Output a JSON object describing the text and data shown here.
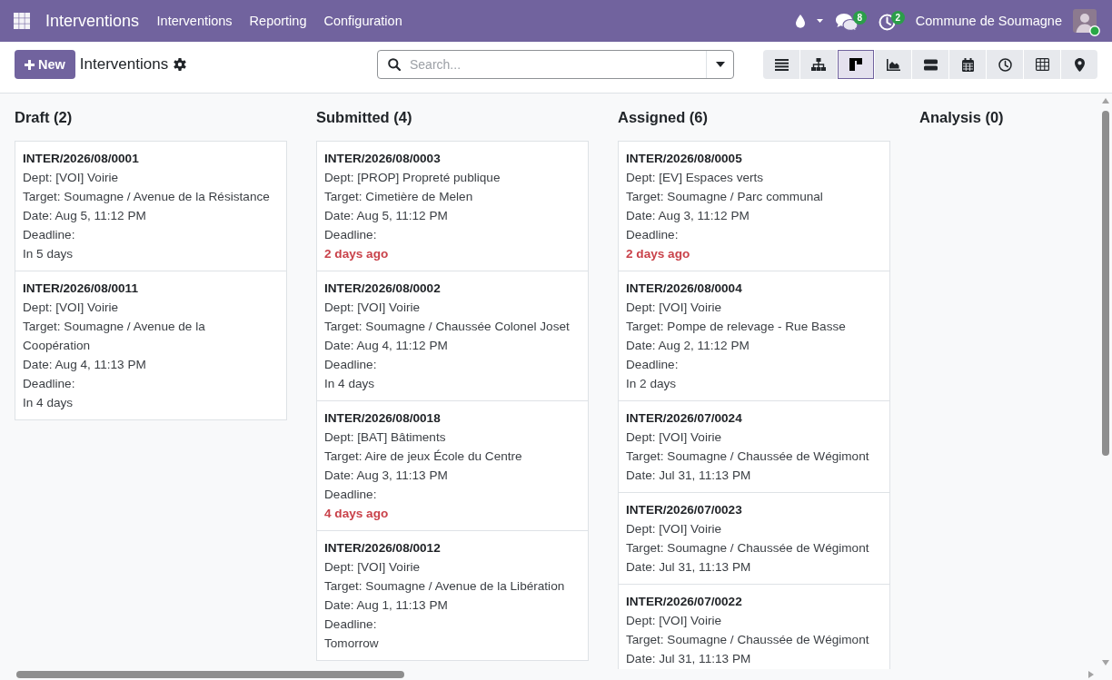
{
  "navbar": {
    "app_name": "Interventions",
    "menu": [
      {
        "label": "Interventions"
      },
      {
        "label": "Reporting"
      },
      {
        "label": "Configuration"
      }
    ],
    "messages_badge": "8",
    "activities_badge": "2",
    "company": "Commune de Soumagne",
    "user_online": true
  },
  "control_panel": {
    "new_button": "New",
    "breadcrumb": "Interventions",
    "search": {
      "placeholder": "Search..."
    },
    "views": [
      {
        "kind": "list",
        "selected": false
      },
      {
        "kind": "hierarchy",
        "selected": false
      },
      {
        "kind": "kanban",
        "selected": true
      },
      {
        "kind": "graph",
        "selected": false
      },
      {
        "kind": "gantt",
        "selected": false
      },
      {
        "kind": "calendar",
        "selected": false
      },
      {
        "kind": "activity",
        "selected": false
      },
      {
        "kind": "pivot",
        "selected": false
      },
      {
        "kind": "map",
        "selected": false
      }
    ]
  },
  "columns": [
    {
      "title": "Draft (2)",
      "cards": [
        {
          "reference": "INTER/2026/08/0001",
          "department": "Dept: [VOI] Voirie",
          "target": "Target: Soumagne / Avenue de la Résistance",
          "date": "Date: Aug 5, 11:12 PM",
          "deadline_label": "Deadline:",
          "deadline": "In 5 days",
          "overdue": false
        },
        {
          "reference": "INTER/2026/08/0011",
          "department": "Dept: [VOI] Voirie",
          "target": "Target: Soumagne / Avenue de la Coopération",
          "date": "Date: Aug 4, 11:13 PM",
          "deadline_label": "Deadline:",
          "deadline": "In 4 days",
          "overdue": false
        }
      ]
    },
    {
      "title": "Submitted (4)",
      "cards": [
        {
          "reference": "INTER/2026/08/0003",
          "department": "Dept: [PROP] Propreté publique",
          "target": "Target: Cimetière de Melen",
          "date": "Date: Aug 5, 11:12 PM",
          "deadline_label": "Deadline:",
          "deadline": "2 days ago",
          "overdue": true
        },
        {
          "reference": "INTER/2026/08/0002",
          "department": "Dept: [VOI] Voirie",
          "target": "Target: Soumagne / Chaussée Colonel Joset",
          "date": "Date: Aug 4, 11:12 PM",
          "deadline_label": "Deadline:",
          "deadline": "In 4 days",
          "overdue": false
        },
        {
          "reference": "INTER/2026/08/0018",
          "department": "Dept: [BAT] Bâtiments",
          "target": "Target: Aire de jeux École du Centre",
          "date": "Date: Aug 3, 11:13 PM",
          "deadline_label": "Deadline:",
          "deadline": "4 days ago",
          "overdue": true
        },
        {
          "reference": "INTER/2026/08/0012",
          "department": "Dept: [VOI] Voirie",
          "target": "Target: Soumagne / Avenue de la Libération",
          "date": "Date: Aug 1, 11:13 PM",
          "deadline_label": "Deadline:",
          "deadline": "Tomorrow",
          "overdue": false
        }
      ]
    },
    {
      "title": "Assigned (6)",
      "cards": [
        {
          "reference": "INTER/2026/08/0005",
          "department": "Dept: [EV] Espaces verts",
          "target": "Target: Soumagne / Parc communal",
          "date": "Date: Aug 3, 11:12 PM",
          "deadline_label": "Deadline:",
          "deadline": "2 days ago",
          "overdue": true
        },
        {
          "reference": "INTER/2026/08/0004",
          "department": "Dept: [VOI] Voirie",
          "target": "Target: Pompe de relevage - Rue Basse",
          "date": "Date: Aug 2, 11:12 PM",
          "deadline_label": "Deadline:",
          "deadline": "In 2 days",
          "overdue": false
        },
        {
          "reference": "INTER/2026/07/0024",
          "department": "Dept: [VOI] Voirie",
          "target": "Target: Soumagne / Chaussée de Wégimont",
          "date": "Date: Jul 31, 11:13 PM"
        },
        {
          "reference": "INTER/2026/07/0023",
          "department": "Dept: [VOI] Voirie",
          "target": "Target: Soumagne / Chaussée de Wégimont",
          "date": "Date: Jul 31, 11:13 PM"
        },
        {
          "reference": "INTER/2026/07/0022",
          "department": "Dept: [VOI] Voirie",
          "target": "Target: Soumagne / Chaussée de Wégimont",
          "date": "Date: Jul 31, 11:13 PM"
        }
      ]
    },
    {
      "title": "Analysis (0)"
    }
  ]
}
